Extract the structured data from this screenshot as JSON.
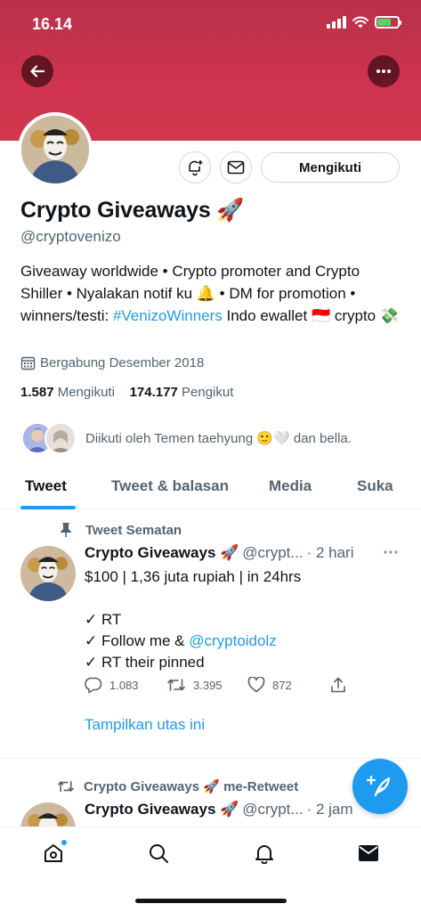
{
  "status_bar": {
    "time": "16.14"
  },
  "profile": {
    "display_name": "Crypto Giveaways 🚀",
    "handle": "@cryptovenizo",
    "follow_button_label": "Mengikuti",
    "bio": {
      "part1": "Giveaway worldwide • Crypto promoter and Crypto Shiller • Nyalakan notif ku 🔔 • DM for promotion • winners/testi: ",
      "hashtag": "#VenizoWinners",
      "part2": " Indo ewallet 🇮🇩 crypto 💸"
    },
    "joined": "Bergabung Desember 2018",
    "following_count": "1.587",
    "following_label": "Mengikuti",
    "followers_count": "174.177",
    "followers_label": "Pengikut",
    "followed_by": "Diikuti oleh Temen taehyung 🙂🤍 dan bella."
  },
  "tabs": [
    {
      "label": "Tweet"
    },
    {
      "label": "Tweet & balasan"
    },
    {
      "label": "Media"
    },
    {
      "label": "Suka"
    }
  ],
  "tweets": [
    {
      "context_label": "Tweet Sematan",
      "name": "Crypto Giveaways 🚀",
      "handle": "@crypt...",
      "time": "· 2 hari",
      "line1": "$100 | 1,36 juta rupiah | in 24hrs",
      "line2": "✓ RT",
      "line3_prefix": "✓ Follow me & ",
      "line3_mention": "@cryptoidolz",
      "line4": "✓ RT their pinned",
      "replies": "1.083",
      "retweets": "3.395",
      "likes": "872",
      "thread_link": "Tampilkan utas ini"
    },
    {
      "context_label": "Crypto Giveaways 🚀 me-Retweet",
      "name": "Crypto Giveaways 🚀",
      "handle": "@crypt...",
      "time": "· 2 jam"
    }
  ],
  "colors": {
    "accent": "#1d9bf0",
    "banner": "#d0334d",
    "text": "#0f1419",
    "muted": "#536471"
  }
}
